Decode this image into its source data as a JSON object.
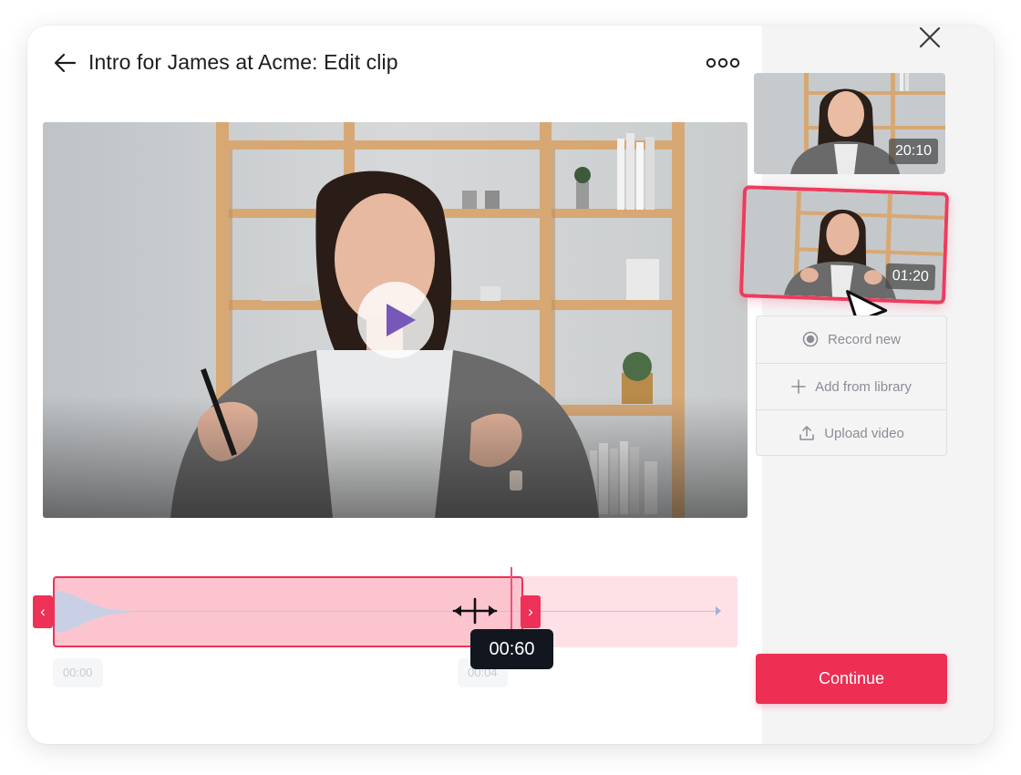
{
  "header": {
    "title": "Intro for James at Acme: Edit clip",
    "back_icon": "arrow-left-icon",
    "more_icon": "more-horizontal-icon"
  },
  "video": {
    "play_icon": "play-icon"
  },
  "timeline": {
    "start_label": "00:00",
    "mid_label": "00:04",
    "playhead_time": "00:60",
    "left_handle": "‹",
    "right_handle": "›"
  },
  "sidebar": {
    "close_icon": "close-icon",
    "clips": [
      {
        "duration": "20:10"
      },
      {
        "duration": "01:20"
      }
    ],
    "actions": [
      {
        "label": "Record new",
        "icon": "record-icon"
      },
      {
        "label": "Add from library",
        "icon": "plus-icon"
      },
      {
        "label": "Upload video",
        "icon": "upload-icon"
      }
    ],
    "continue_label": "Continue"
  },
  "colors": {
    "accent": "#ec2f53",
    "play": "#7758b8",
    "selection": "#fcc4cf"
  }
}
